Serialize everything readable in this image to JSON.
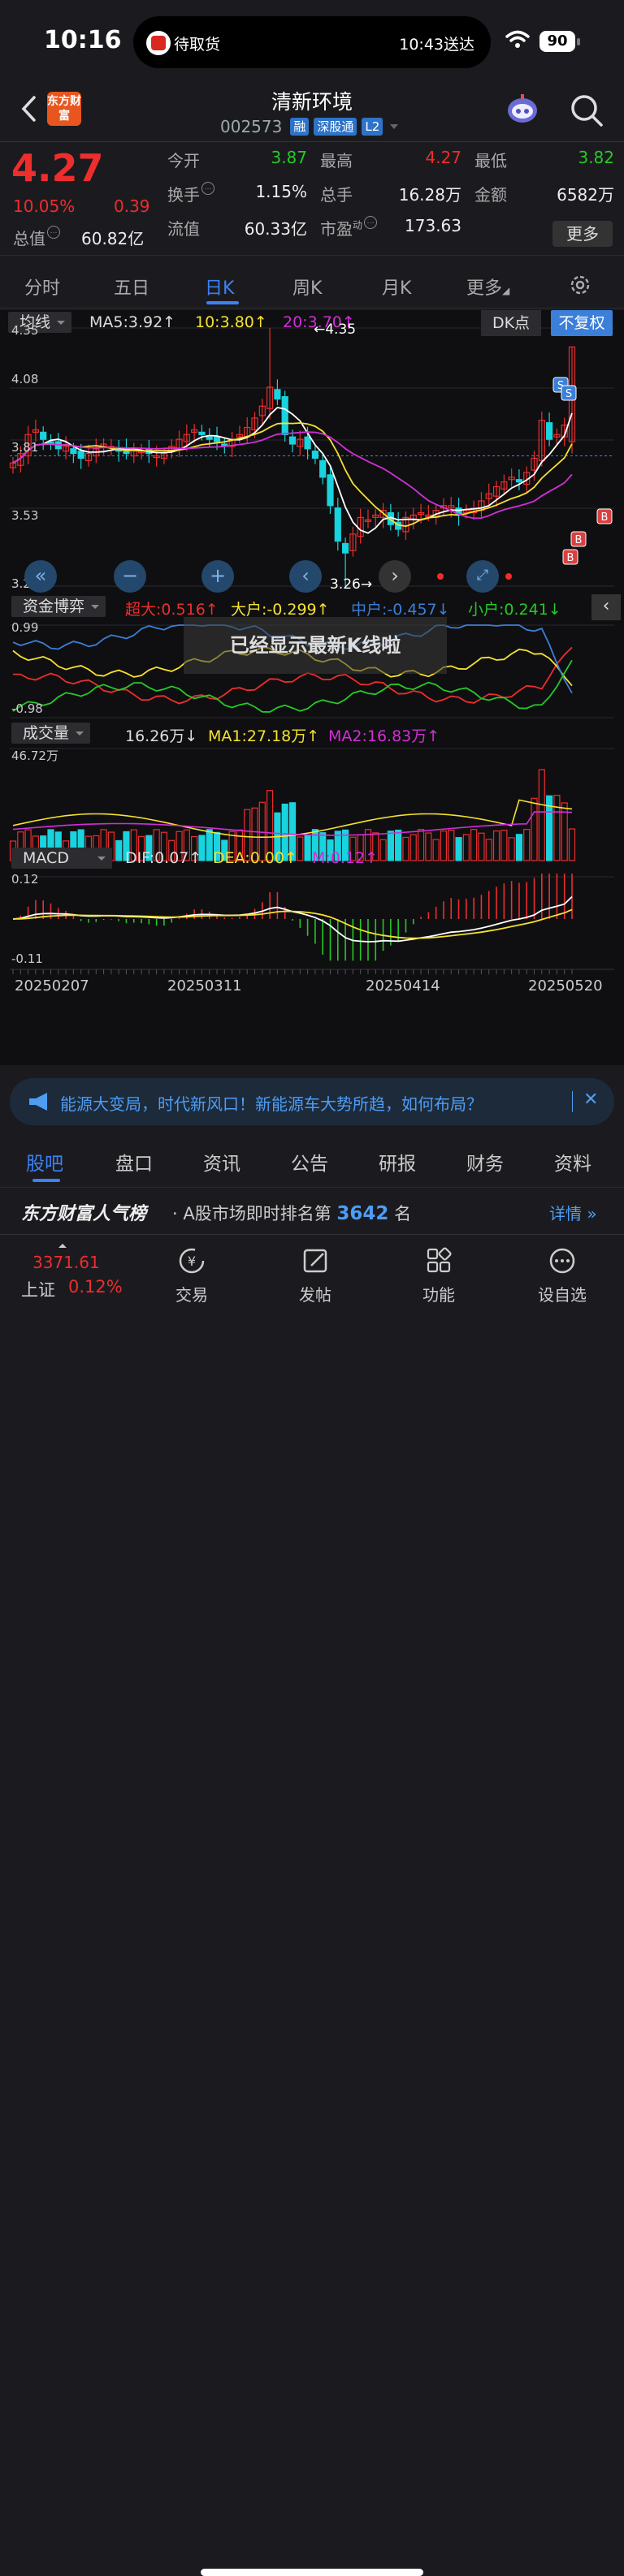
{
  "status_bar": {
    "time": "10:16",
    "island_left": "待取货",
    "island_right": "10:43送达",
    "battery": "90"
  },
  "header": {
    "logo_text": "东方财富",
    "stock_name": "清新环境",
    "code": "002573",
    "tags": [
      "融",
      "深股通",
      "L2"
    ]
  },
  "quote": {
    "price": "4.27",
    "pct": "10.05%",
    "change": "0.39",
    "total_value_label": "总值",
    "total_value": "60.82亿",
    "fields": [
      {
        "label": "今开",
        "value": "3.87",
        "color": "#26c926"
      },
      {
        "label": "最高",
        "value": "4.27",
        "color": "#ee2d2d"
      },
      {
        "label": "最低",
        "value": "3.82",
        "color": "#26c926"
      },
      {
        "label": "换手",
        "value": "1.15%",
        "color": "#eeeeee"
      },
      {
        "label": "总手",
        "value": "16.28万",
        "color": "#eeeeee"
      },
      {
        "label": "金额",
        "value": "6582万",
        "color": "#eeeeee"
      },
      {
        "label": "流值",
        "value": "60.33亿",
        "color": "#eeeeee"
      },
      {
        "label": "市盈",
        "value": "173.63",
        "color": "#eeeeee"
      }
    ],
    "pe_superscript": "动",
    "more": "更多"
  },
  "tabs": [
    "分时",
    "五日",
    "日K",
    "周K",
    "月K",
    "更多"
  ],
  "kline": {
    "indicator": "均线",
    "ma5": "MA5:3.92↑",
    "ma10": "10:3.80↑",
    "ma20": "20:3.70↑",
    "dk_label": "DK点",
    "fq_label": "不复权",
    "y_ticks": [
      "4.35",
      "4.08",
      "3.81",
      "3.53",
      "3.26"
    ],
    "high_mark": "←4.35",
    "low_mark": "3.26→",
    "signals": [
      "S",
      "S",
      "B",
      "B",
      "B"
    ]
  },
  "toast": "已经显示最新K线啦",
  "fund": {
    "indicator": "资金博弈",
    "super": "超大:0.516↑",
    "big": "大户:-0.299↑",
    "mid": "中户:-0.457↓",
    "small": "小户:0.241↓",
    "y_top": "0.99",
    "y_bottom": "-0.98"
  },
  "volume": {
    "indicator": "成交量",
    "vol": "16.26万↓",
    "ma1": "MA1:27.18万↑",
    "ma2": "MA2:16.83万↑",
    "y_top": "46.72万"
  },
  "macd": {
    "indicator": "MACD",
    "dif": "DIF:0.07↑",
    "dea": "DEA:0.00↑",
    "m": "M:0.12↑",
    "y_top": "0.12",
    "y_bottom": "-0.11"
  },
  "dates": [
    "20250207",
    "20250311",
    "20250414",
    "20250520"
  ],
  "banner": "能源大变局，时代新风口！新能源车大势所趋，如何布局？",
  "subtabs": [
    "股吧",
    "盘口",
    "资讯",
    "公告",
    "研报",
    "财务",
    "资料"
  ],
  "rank": {
    "brand": "东方财富人气榜",
    "text_pre": "A股市场即时排名第",
    "num": "3642",
    "text_post": "名",
    "more": "详情"
  },
  "bottom_nav": {
    "index_value": "3371.61",
    "index_name": "上证",
    "index_pct": "0.12%",
    "items": [
      "交易",
      "发帖",
      "功能",
      "设自选"
    ]
  },
  "colors": {
    "up": "#ee2d2d",
    "down": "#26c926",
    "accent": "#3b82f6",
    "ma5": "#ffffff",
    "ma10": "#f5e12f",
    "ma20": "#d22ed8"
  },
  "chart_data": {
    "type": "candlestick",
    "x_labels": [
      "20250207",
      "20250311",
      "20250414",
      "20250520"
    ],
    "ylim": [
      3.26,
      4.35
    ],
    "last": {
      "open": 3.87,
      "high": 4.27,
      "low": 3.82,
      "close": 4.27
    },
    "ma": {
      "MA5": 3.92,
      "MA10": 3.8,
      "MA20": 3.7
    },
    "period_high": 4.35,
    "period_low": 3.26,
    "closes": [
      3.78,
      3.82,
      3.9,
      3.92,
      3.88,
      3.86,
      3.84,
      3.85,
      3.82,
      3.8,
      3.82,
      3.84,
      3.86,
      3.85,
      3.83,
      3.82,
      3.84,
      3.83,
      3.82,
      3.81,
      3.82,
      3.85,
      3.88,
      3.9,
      3.92,
      3.9,
      3.88,
      3.87,
      3.86,
      3.88,
      3.9,
      3.93,
      3.97,
      4.02,
      4.1,
      4.05,
      3.9,
      3.86,
      3.88,
      3.84,
      3.8,
      3.72,
      3.6,
      3.45,
      3.4,
      3.48,
      3.55,
      3.54,
      3.56,
      3.58,
      3.52,
      3.5,
      3.55,
      3.56,
      3.57,
      3.56,
      3.58,
      3.6,
      3.6,
      3.56,
      3.58,
      3.59,
      3.62,
      3.65,
      3.68,
      3.7,
      3.72,
      3.7,
      3.74,
      3.8,
      3.96,
      3.88,
      3.9,
      3.94,
      4.27
    ]
  }
}
